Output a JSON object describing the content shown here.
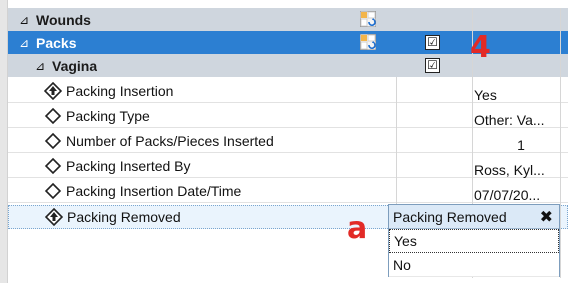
{
  "groups": [
    {
      "label": "Wounds"
    },
    {
      "label": "Packs"
    },
    {
      "label": "Vagina"
    }
  ],
  "expand_glyph": "⊿",
  "items": [
    {
      "label": "Packing Insertion",
      "value": "Yes",
      "icon": "required-diamond-icon"
    },
    {
      "label": "Packing Type",
      "value": "Other: Va...",
      "icon": "diamond-icon"
    },
    {
      "label": "Number of Packs/Pieces Inserted",
      "value": "1",
      "icon": "diamond-icon"
    },
    {
      "label": "Packing Inserted By",
      "value": "Ross, Kyl...",
      "icon": "diamond-icon"
    },
    {
      "label": "Packing Insertion Date/Time",
      "value": "07/07/20...",
      "icon": "diamond-icon"
    },
    {
      "label": "Packing Removed",
      "value": "",
      "icon": "required-diamond-icon"
    }
  ],
  "checkbox_glyph": "☑",
  "dropdown": {
    "title": "Packing Removed",
    "close_glyph": "✖",
    "options": [
      "Yes",
      "No"
    ]
  },
  "annotations": {
    "number": "4",
    "letter": "a"
  },
  "colors": {
    "selected_row": "#2c7fd2",
    "group_header": "#cfd6de",
    "annotation": "#e22a26"
  }
}
